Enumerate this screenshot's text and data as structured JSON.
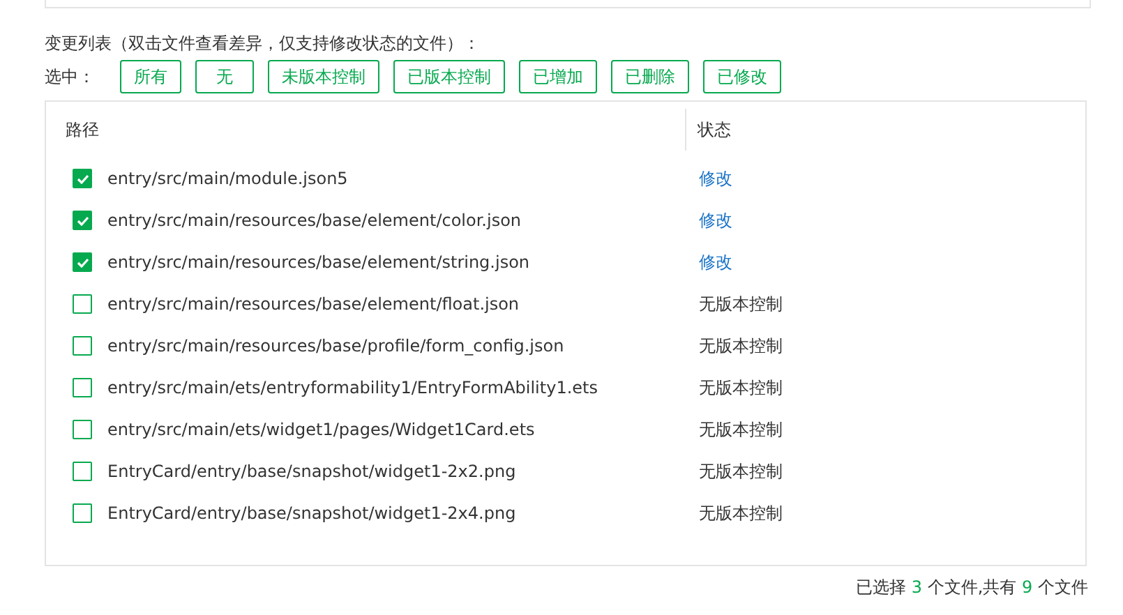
{
  "title": "变更列表（双击文件查看差异，仅支持修改状态的文件）：",
  "select_label": "选中：",
  "select_buttons": [
    "所有",
    "无",
    "未版本控制",
    "已版本控制",
    "已增加",
    "已删除",
    "已修改"
  ],
  "table": {
    "columns": [
      "路径",
      "状态"
    ],
    "rows": [
      {
        "checked": true,
        "path": "entry/src/main/module.json5",
        "status": "修改",
        "kind": "modified"
      },
      {
        "checked": true,
        "path": "entry/src/main/resources/base/element/color.json",
        "status": "修改",
        "kind": "modified"
      },
      {
        "checked": true,
        "path": "entry/src/main/resources/base/element/string.json",
        "status": "修改",
        "kind": "modified"
      },
      {
        "checked": false,
        "path": "entry/src/main/resources/base/element/float.json",
        "status": "无版本控制",
        "kind": "unversioned"
      },
      {
        "checked": false,
        "path": "entry/src/main/resources/base/profile/form_config.json",
        "status": "无版本控制",
        "kind": "unversioned"
      },
      {
        "checked": false,
        "path": "entry/src/main/ets/entryformability1/EntryFormAbility1.ets",
        "status": "无版本控制",
        "kind": "unversioned"
      },
      {
        "checked": false,
        "path": "entry/src/main/ets/widget1/pages/Widget1Card.ets",
        "status": "无版本控制",
        "kind": "unversioned"
      },
      {
        "checked": false,
        "path": "EntryCard/entry/base/snapshot/widget1-2x2.png",
        "status": "无版本控制",
        "kind": "unversioned"
      },
      {
        "checked": false,
        "path": "EntryCard/entry/base/snapshot/widget1-2x4.png",
        "status": "无版本控制",
        "kind": "unversioned"
      }
    ]
  },
  "footer": {
    "prefix": "已选择",
    "selected_count": "3",
    "middle": "个文件,共有",
    "total_count": "9",
    "suffix": "个文件"
  }
}
